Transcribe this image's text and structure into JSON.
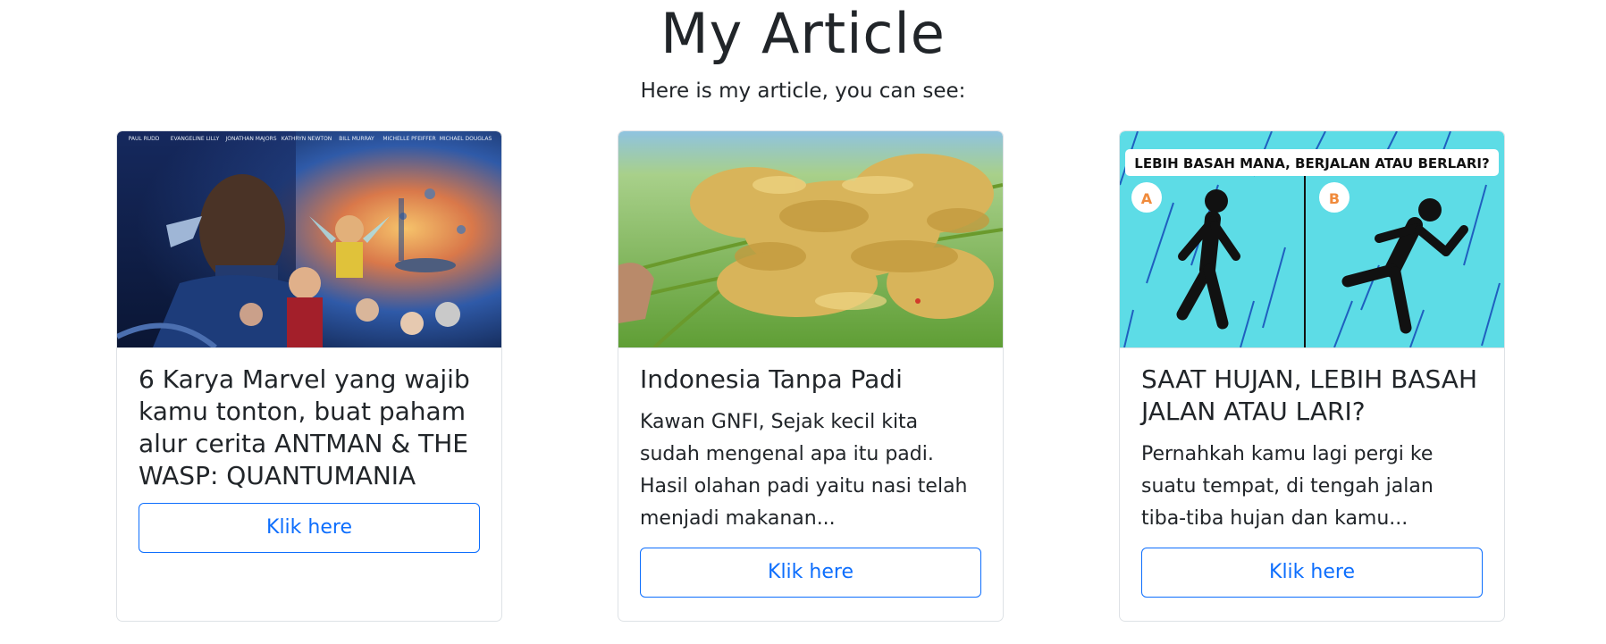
{
  "header": {
    "title": "My Article",
    "subtitle": "Here is my article, you can see:"
  },
  "cards": [
    {
      "image_alt": "Ant-Man and the Wasp: Quantumania movie poster",
      "poster_names": [
        "PAUL RUDD",
        "EVANGELINE LILLY",
        "JONATHAN MAJORS",
        "KATHRYN NEWTON",
        "BILL MURRAY",
        "MICHELLE PFEIFFER",
        "MICHAEL DOUGLAS"
      ],
      "title": "6 Karya Marvel yang wajib kamu tonton, buat paham alur cerita ANTMAN & THE WASP: QUANTUMANIA",
      "text": "",
      "button_label": "Klik here"
    },
    {
      "image_alt": "Rice paddy stalks held in hand",
      "title": "Indonesia Tanpa Padi",
      "text": "Kawan GNFI, Sejak kecil kita sudah mengenal apa itu padi. Hasil olahan padi yaitu nasi telah menjadi makanan...",
      "button_label": "Klik here"
    },
    {
      "image_alt": "Illustration: walking vs running in the rain",
      "image_heading": "LEBIH BASAH MANA,  BERJALAN ATAU BERLARI?",
      "label_a": "A",
      "label_b": "B",
      "title": "SAAT HUJAN, LEBIH BASAH JALAN ATAU LARI?",
      "text": "Pernahkah kamu lagi pergi ke suatu tempat, di tengah jalan tiba-tiba hujan dan kamu...",
      "button_label": "Klik here"
    }
  ],
  "colors": {
    "accent": "#0d6efd",
    "text": "#212529",
    "border": "#dee2e6",
    "rain_bg": "#5ddce6"
  }
}
